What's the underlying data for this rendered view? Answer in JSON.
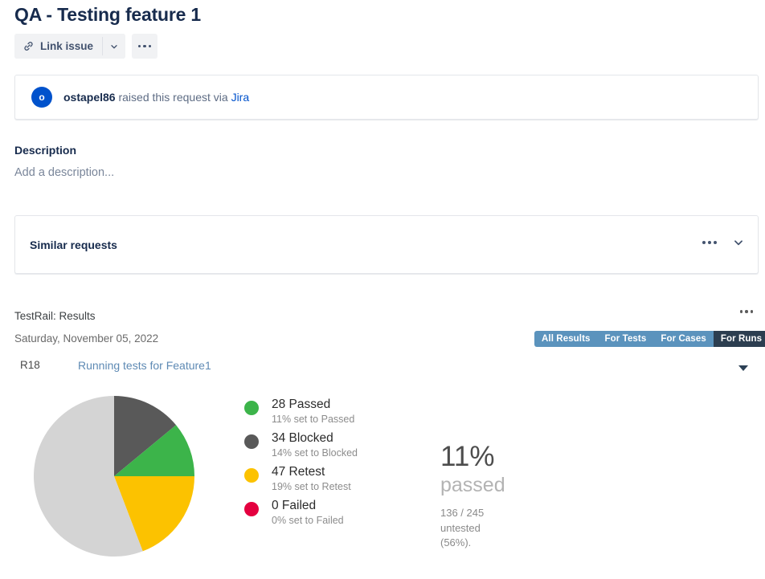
{
  "page": {
    "title": "QA - Testing feature 1"
  },
  "toolbar": {
    "link_issue_label": "Link issue",
    "link_icon": "chain-link-icon",
    "caret_icon": "chevron-down-icon",
    "more_icon": "ellipsis-icon"
  },
  "jira_banner": {
    "avatar_initial": "o",
    "reporter": "ostapel86",
    "middle_text": " raised this request via ",
    "app": "Jira"
  },
  "description": {
    "label": "Description",
    "placeholder": "Add a description..."
  },
  "similar_requests": {
    "title": "Similar requests",
    "more_icon": "ellipsis-icon",
    "collapse_icon": "chevron-down-icon"
  },
  "testrail": {
    "title": "TestRail: Results",
    "date": "Saturday, November 05, 2022",
    "panel_more_icon": "ellipsis-icon",
    "tabs": [
      {
        "label": "All Results",
        "active": false
      },
      {
        "label": "For Tests",
        "active": false
      },
      {
        "label": "For Cases",
        "active": false
      },
      {
        "label": "For Runs",
        "active": true
      }
    ],
    "run": {
      "id": "R18",
      "name": "Running tests for Feature1",
      "expand_icon": "caret-down-icon"
    },
    "summary": {
      "percent": "11%",
      "word": "passed",
      "detail": "136 / 245 untested (56%)."
    },
    "colors": {
      "passed": "#3cb44a",
      "blocked": "#595959",
      "retest": "#fcc200",
      "failed": "#e4003f",
      "untested": "#d4d4d4",
      "tab_bg": "#5b93bd",
      "tab_active_bg": "#2c3e50",
      "link": "#5e8ab4",
      "jira_blue": "#0052cc"
    }
  },
  "chart_data": {
    "type": "pie",
    "title": "TestRail: Results",
    "legend_position": "right",
    "total": 245,
    "categories": [
      "Blocked",
      "Passed",
      "Retest",
      "Untested"
    ],
    "values": [
      34,
      28,
      47,
      136
    ],
    "slices": [
      {
        "label": "Blocked",
        "value": 34,
        "percent": 14,
        "color": "#595959",
        "start_angle": 0,
        "end_angle": 50.4
      },
      {
        "label": "Passed",
        "value": 28,
        "percent": 11,
        "color": "#3cb44a",
        "start_angle": 50.4,
        "end_angle": 90
      },
      {
        "label": "Retest",
        "value": 47,
        "percent": 19,
        "color": "#fcc200",
        "start_angle": 90,
        "end_angle": 159.1
      },
      {
        "label": "Untested",
        "value": 136,
        "percent": 56,
        "color": "#d4d4d4",
        "start_angle": 159.1,
        "end_angle": 360
      }
    ],
    "legend": [
      {
        "count": "28",
        "label": "Passed",
        "main": "28 Passed",
        "sub": "11% set to Passed",
        "color": "#3cb44a"
      },
      {
        "count": "34",
        "label": "Blocked",
        "main": "34 Blocked",
        "sub": "14% set to Blocked",
        "color": "#595959"
      },
      {
        "count": "47",
        "label": "Retest",
        "main": "47 Retest",
        "sub": "19% set to Retest",
        "color": "#fcc200"
      },
      {
        "count": "0",
        "label": "Failed",
        "main": "0 Failed",
        "sub": "0% set to Failed",
        "color": "#e4003f"
      }
    ]
  }
}
